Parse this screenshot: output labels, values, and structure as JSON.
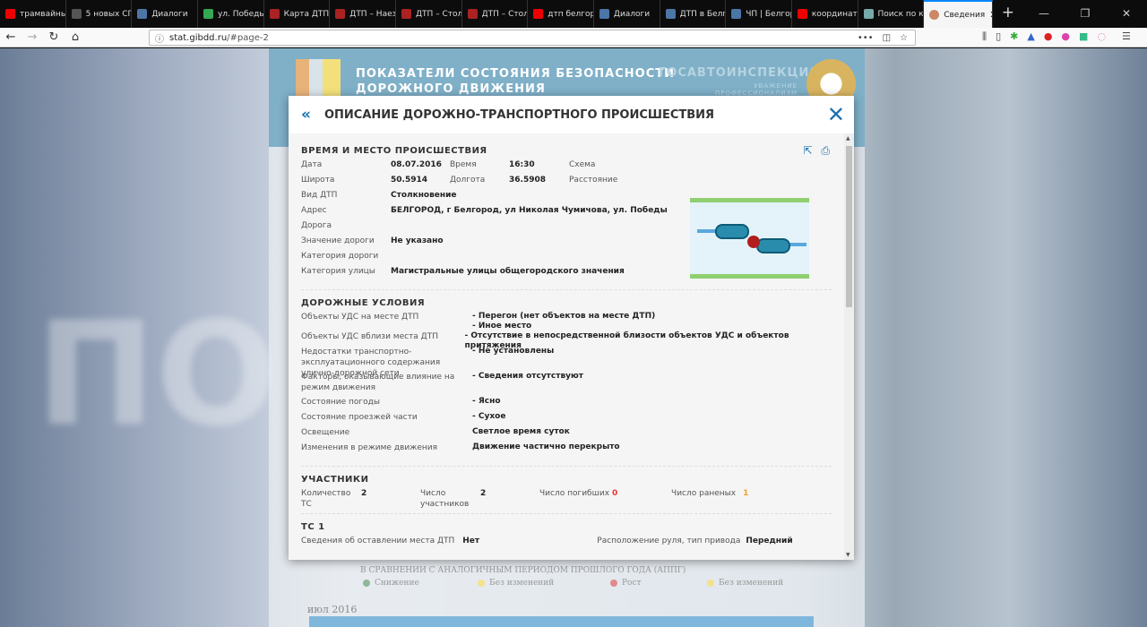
{
  "browser": {
    "tabs": [
      {
        "label": "трамвайный",
        "color": "#e00"
      },
      {
        "label": "5 новых СП",
        "color": "#555"
      },
      {
        "label": "Диалоги",
        "color": "#4a76a8"
      },
      {
        "label": "ул. Победы",
        "color": "#34a853"
      },
      {
        "label": "Карта ДТП –",
        "color": "#a22"
      },
      {
        "label": "ДТП – Наезд",
        "color": "#a22"
      },
      {
        "label": "ДТП – Столк",
        "color": "#a22"
      },
      {
        "label": "ДТП – Столк",
        "color": "#a22"
      },
      {
        "label": "дтп белгород",
        "color": "#e00"
      },
      {
        "label": "Диалоги",
        "color": "#4a76a8"
      },
      {
        "label": "ДТП в Белгор",
        "color": "#4a76a8"
      },
      {
        "label": "ЧП | Белгоро",
        "color": "#4a76a8"
      },
      {
        "label": "координаты",
        "color": "#e00"
      },
      {
        "label": "Поиск по ко",
        "color": "#7aa"
      }
    ],
    "active_tab": "Сведения",
    "url_host": "stat.gibdd.ru",
    "url_path": "/#page-2"
  },
  "site": {
    "title_line1": "ПОКАЗАТЕЛИ СОСТОЯНИЯ БЕЗОПАСНОСТИ",
    "title_line2": "ДОРОЖНОГО ДВИЖЕНИЯ",
    "brand": "ГОСАВТОИНСПЕКЦИЯ",
    "slogan": "УВАЖЕНИЕ ПРОФЕССИОНАЛИЗМ",
    "legend_title": "В СРАВНЕНИИ С АНАЛОГИЧНЫМ ПЕРИОДОМ ПРОШЛОГО ГОДА (АППГ)",
    "legend": [
      {
        "label": "Снижение",
        "color": "#8fb89a"
      },
      {
        "label": "Без изменений",
        "color": "#f3e28a"
      },
      {
        "label": "Рост",
        "color": "#e28a8a"
      },
      {
        "label": "Без изменений",
        "color": "#f3e28a"
      }
    ],
    "timeline": "июл 2016"
  },
  "modal": {
    "title": "ОПИСАНИЕ ДОРОЖНО-ТРАНСПОРТНОГО ПРОИСШЕСТВИЯ",
    "s1": {
      "title": "ВРЕМЯ И МЕСТО ПРОИСШЕСТВИЯ",
      "date_l": "Дата",
      "date": "08.07.2016",
      "time_l": "Время",
      "time": "16:30",
      "scheme_l": "Схема",
      "lat_l": "Широта",
      "lat": "50.5914",
      "lon_l": "Долгота",
      "lon": "36.5908",
      "dist_l": "Расстояние",
      "rows": [
        {
          "l": "Вид ДТП",
          "v": "Столкновение"
        },
        {
          "l": "Адрес",
          "v": "БЕЛГОРОД, г Белгород, ул Николая Чумичова, ул. Победы"
        },
        {
          "l": "Дорога",
          "v": ""
        },
        {
          "l": "Значение дороги",
          "v": "Не указано"
        },
        {
          "l": "Категория дороги",
          "v": ""
        },
        {
          "l": "Категория улицы",
          "v": "Магистральные улицы общегородского значения"
        }
      ]
    },
    "s2": {
      "title": "ДОРОЖНЫЕ УСЛОВИЯ",
      "rows": [
        {
          "l": "Объекты УДС на месте ДТП",
          "v": "- Перегон (нет объектов на месте ДТП)",
          "v2": "- Иное место"
        },
        {
          "l": "Объекты УДС вблизи места ДТП",
          "v": "- Отсутствие в непосредственной близости объектов УДС и объектов притяжения"
        },
        {
          "l": "Недостатки транспортно-эксплуатационного содержания улично-дорожной сети",
          "v": "- Не установлены"
        },
        {
          "l": "Факторы, оказывающие влияние на режим движения",
          "v": "- Сведения отсутствуют"
        },
        {
          "l": "Состояние погоды",
          "v": "- Ясно"
        },
        {
          "l": "Состояние проезжей части",
          "v": "- Сухое"
        },
        {
          "l": "Освещение",
          "v": "Светлое время суток"
        },
        {
          "l": "Изменения в режиме движения",
          "v": "Движение частично перекрыто"
        }
      ]
    },
    "s3": {
      "title": "УЧАСТНИКИ",
      "vehicles_l": "Количество ТС",
      "vehicles": "2",
      "part_l": "Число участников",
      "part": "2",
      "dead_l": "Число погибших",
      "dead": "0",
      "inj_l": "Число раненых",
      "inj": "1"
    },
    "s4": {
      "title": "ТС 1",
      "left_l": "Сведения об оставлении места ДТП",
      "left": "Нет",
      "wheel_l": "Расположение руля, тип привода",
      "wheel": "Передний"
    }
  }
}
